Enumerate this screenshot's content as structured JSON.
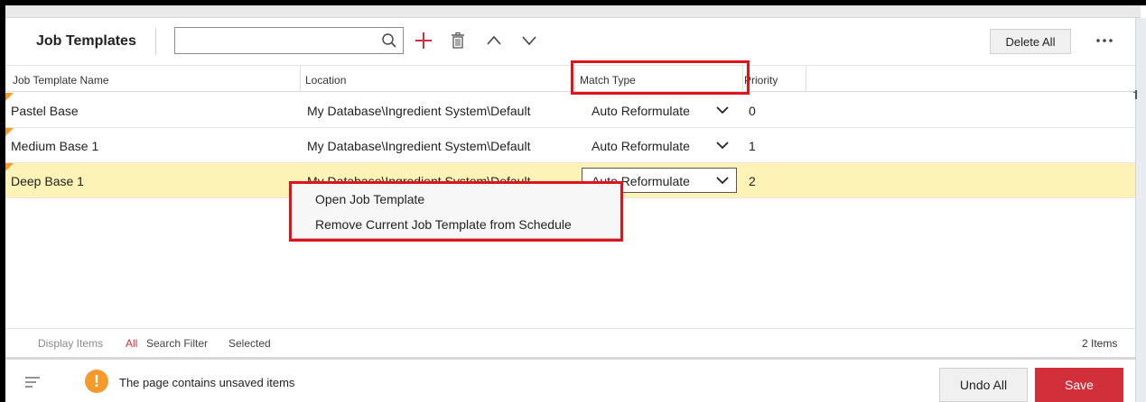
{
  "toolbar": {
    "title": "Job Templates",
    "search_value": "",
    "delete_all_label": "Delete All"
  },
  "columns": {
    "name": "Job Template Name",
    "location": "Location",
    "match_type": "Match Type",
    "priority": "Priority"
  },
  "rows": [
    {
      "name": "Pastel Base",
      "location": "My Database\\Ingredient System\\Default",
      "match_type": "Auto Reformulate",
      "priority": "0"
    },
    {
      "name": "Medium Base 1",
      "location": "My Database\\Ingredient System\\Default",
      "match_type": "Auto Reformulate",
      "priority": "1"
    },
    {
      "name": "Deep Base 1",
      "location": "My Database\\Ingredient System\\Default",
      "match_type": "Auto Reformulate",
      "priority": "2"
    }
  ],
  "context_menu": {
    "items": [
      "Open Job Template",
      "Remove Current Job Template from Schedule"
    ]
  },
  "footer": {
    "display_items_label": "Display Items",
    "filters": [
      "All",
      "Search Filter",
      "Selected"
    ],
    "count_text": "2 Items"
  },
  "status": {
    "message": "The page contains unsaved items",
    "undo_label": "Undo All",
    "save_label": "Save"
  },
  "colors": {
    "accent_red": "#d1303a",
    "selected_row": "#fdf3b7",
    "warning_orange": "#f39a2d",
    "annotation_red": "#e0121b"
  },
  "icons": [
    "search-icon",
    "add-icon",
    "trash-icon",
    "chevron-up-icon",
    "chevron-down-icon",
    "more-icon",
    "menu-lines-icon",
    "warning-icon"
  ]
}
